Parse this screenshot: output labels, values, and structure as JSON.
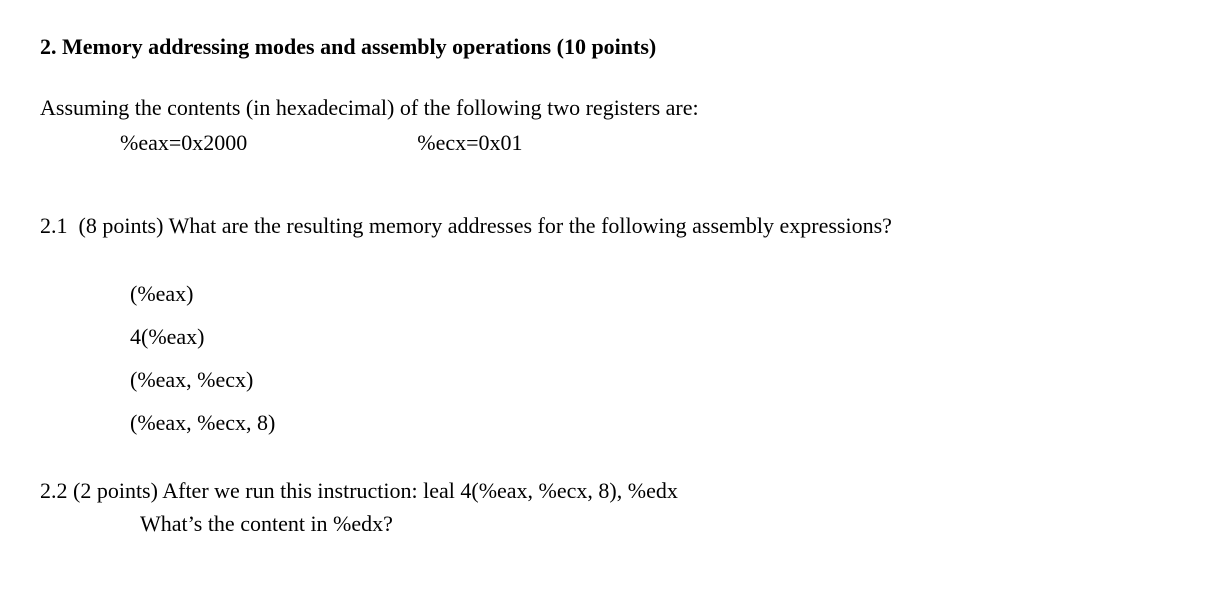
{
  "title": "2. Memory addressing modes and assembly operations (10 points)",
  "intro": "Assuming the contents (in hexadecimal) of the following two registers are:",
  "registers": {
    "eax": "%eax=0x2000",
    "ecx": "%ecx=0x01"
  },
  "q21": {
    "label": "2.1",
    "points": "(8 points)",
    "prompt": "What are the resulting memory addresses for the following assembly expressions?",
    "expressions": [
      "(%eax)",
      "4(%eax)",
      "(%eax, %ecx)",
      "(%eax, %ecx, 8)"
    ]
  },
  "q22": {
    "line1": "2.2 (2 points) After we run this instruction: leal 4(%eax, %ecx, 8), %edx",
    "line2": "What’s the content in %edx?"
  }
}
